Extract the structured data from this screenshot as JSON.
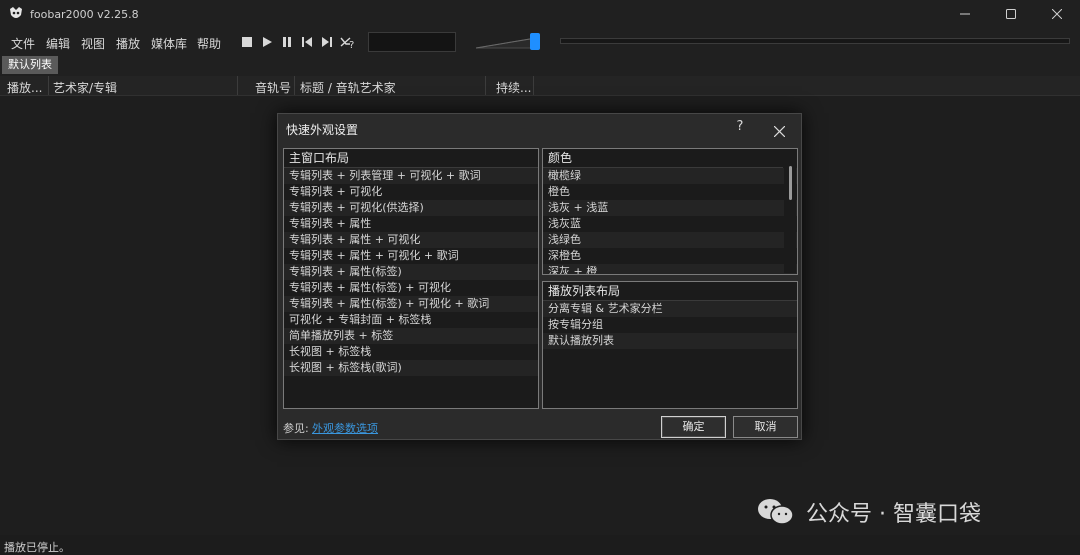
{
  "window": {
    "title": "foobar2000 v2.25.8",
    "minimize_icon": "minimize-icon",
    "maximize_icon": "maximize-icon",
    "close_icon": "close-icon"
  },
  "menu": {
    "items": [
      "文件",
      "编辑",
      "视图",
      "播放",
      "媒体库",
      "帮助"
    ]
  },
  "toolbar": {
    "icons": [
      "stop-icon",
      "play-icon",
      "pause-icon",
      "previous-icon",
      "next-icon",
      "random-icon"
    ],
    "volume_percent": 100
  },
  "tabs": [
    "默认列表"
  ],
  "columns": [
    "播放...",
    "艺术家/专辑",
    "音轨号",
    "标题 / 音轨艺术家",
    "持续..."
  ],
  "status": {
    "text": "播放已停止。"
  },
  "dialog": {
    "title": "快速外观设置",
    "help_label": "?",
    "layout_list": {
      "header": "主窗口布局",
      "items": [
        "专辑列表 + 列表管理 + 可视化 + 歌词",
        "专辑列表 + 可视化",
        "专辑列表 + 可视化(供选择)",
        "专辑列表 + 属性",
        "专辑列表 + 属性 + 可视化",
        "专辑列表 + 属性 + 可视化 + 歌词",
        "专辑列表 + 属性(标签)",
        "专辑列表 + 属性(标签) + 可视化",
        "专辑列表 + 属性(标签) + 可视化 + 歌词",
        "可视化 + 专辑封面 + 标签栈",
        "简单播放列表 + 标签",
        "长视图 + 标签栈",
        "长视图 + 标签栈(歌词)"
      ]
    },
    "color_list": {
      "header": "颜色",
      "items": [
        "橄榄绿",
        "橙色",
        "浅灰 + 浅蓝",
        "浅灰蓝",
        "浅绿色",
        "深橙色",
        "深灰 + 橙"
      ]
    },
    "playlist_layout_list": {
      "header": "播放列表布局",
      "items": [
        "分离专辑 & 艺术家分栏",
        "按专辑分组",
        "默认播放列表"
      ]
    },
    "see_also_label": "参见:",
    "see_also_link": "外观参数选项",
    "ok_label": "确定",
    "cancel_label": "取消"
  },
  "watermark": {
    "text": "公众号 · 智囊口袋",
    "logo_icon": "wechat-logo-icon"
  }
}
